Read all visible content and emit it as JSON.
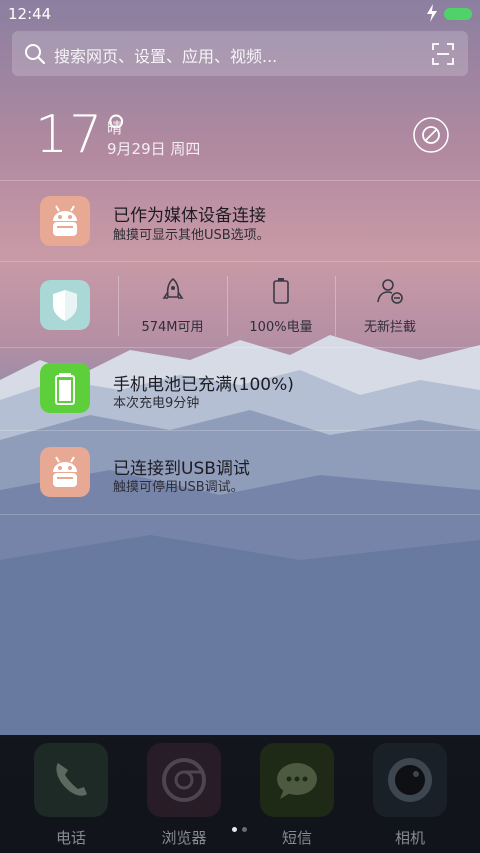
{
  "status_bar": {
    "time": "12:44",
    "battery_color": "#4fd26a"
  },
  "search": {
    "placeholder": "搜索网页、设置、应用、视频..."
  },
  "weather": {
    "temperature": "17°",
    "condition": "晴",
    "date": "9月29日 周四"
  },
  "notifications": [
    {
      "title": "已作为媒体设备连接",
      "subtitle": "触摸可显示其他USB选项。",
      "icon": "android-icon"
    },
    {
      "title": "手机电池已充满(100%)",
      "subtitle": "本次充电9分钟",
      "icon": "battery-icon"
    },
    {
      "title": "已连接到USB调试",
      "subtitle": "触摸可停用USB调试。",
      "icon": "android-icon"
    }
  ],
  "tools": {
    "shield_icon": "shield-icon",
    "items": [
      {
        "label": "574M可用",
        "icon": "rocket-icon"
      },
      {
        "label": "100%电量",
        "icon": "battery-outline-icon"
      },
      {
        "label": "无新拦截",
        "icon": "user-block-icon"
      }
    ]
  },
  "dock": {
    "items": [
      {
        "label": "电话",
        "icon": "phone-icon"
      },
      {
        "label": "浏览器",
        "icon": "browser-icon"
      },
      {
        "label": "短信",
        "icon": "message-icon"
      },
      {
        "label": "相机",
        "icon": "camera-icon"
      }
    ],
    "pages": 2,
    "current_page": 1
  },
  "colors": {
    "android_tile": "#e7a894",
    "shield_tile": "#a9d8d6",
    "battery_tile": "#5ccf3a",
    "battery_full": "#4fd26a"
  }
}
